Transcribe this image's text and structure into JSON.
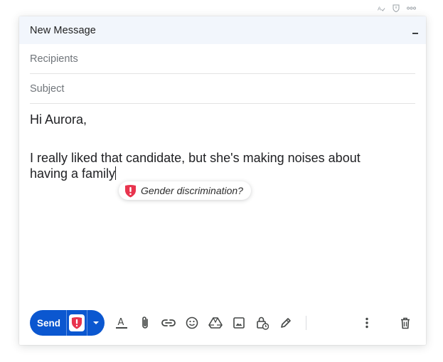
{
  "window": {
    "title": "New Message"
  },
  "fields": {
    "recipients_placeholder": "Recipients",
    "subject_placeholder": "Subject"
  },
  "body": {
    "line1": "Hi Aurora,",
    "line2": "I really liked that candidate, but she's making noises about",
    "line3": "having a family"
  },
  "suggestion": {
    "label": "Gender discrimination?",
    "icon": "shield-alert-icon"
  },
  "toolbar": {
    "send_label": "Send",
    "icons": [
      "text-format-icon",
      "attach-icon",
      "link-icon",
      "emoji-icon",
      "drive-icon",
      "photo-icon",
      "confidential-icon",
      "signature-icon",
      "more-vert-icon",
      "trash-icon"
    ]
  },
  "colors": {
    "send_blue": "#0b57d0",
    "alert_red": "#e8344e",
    "header_bg": "#f2f6fc"
  }
}
